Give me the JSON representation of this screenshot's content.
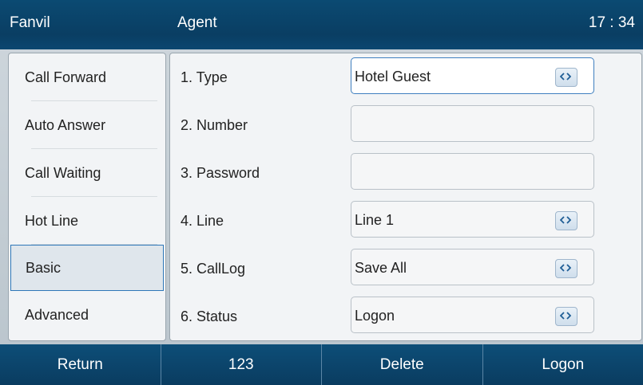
{
  "header": {
    "brand": "Fanvil",
    "title": "Agent",
    "clock": "17 : 34"
  },
  "sidebar": {
    "items": [
      {
        "label": "Call Forward"
      },
      {
        "label": "Auto Answer"
      },
      {
        "label": "Call Waiting"
      },
      {
        "label": "Hot Line"
      },
      {
        "label": "Basic",
        "active": true
      },
      {
        "label": "Advanced"
      }
    ]
  },
  "form": {
    "rows": [
      {
        "label": "1. Type",
        "value": "Hotel Guest",
        "has_selector": true,
        "focused": true
      },
      {
        "label": "2. Number",
        "value": "",
        "has_selector": false
      },
      {
        "label": "3. Password",
        "value": "",
        "has_selector": false
      },
      {
        "label": "4. Line",
        "value": "Line 1",
        "has_selector": true
      },
      {
        "label": "5. CallLog",
        "value": "Save All",
        "has_selector": true
      },
      {
        "label": "6. Status",
        "value": "Logon",
        "has_selector": true
      }
    ]
  },
  "softkeys": [
    {
      "label": "Return"
    },
    {
      "label": "123"
    },
    {
      "label": "Delete"
    },
    {
      "label": "Logon"
    }
  ],
  "icons": {
    "selector": "left-right-arrow-icon"
  },
  "colors": {
    "header": "#0a3e63",
    "focus_border": "#3f7fbf",
    "softkey": "#0a3c60"
  }
}
